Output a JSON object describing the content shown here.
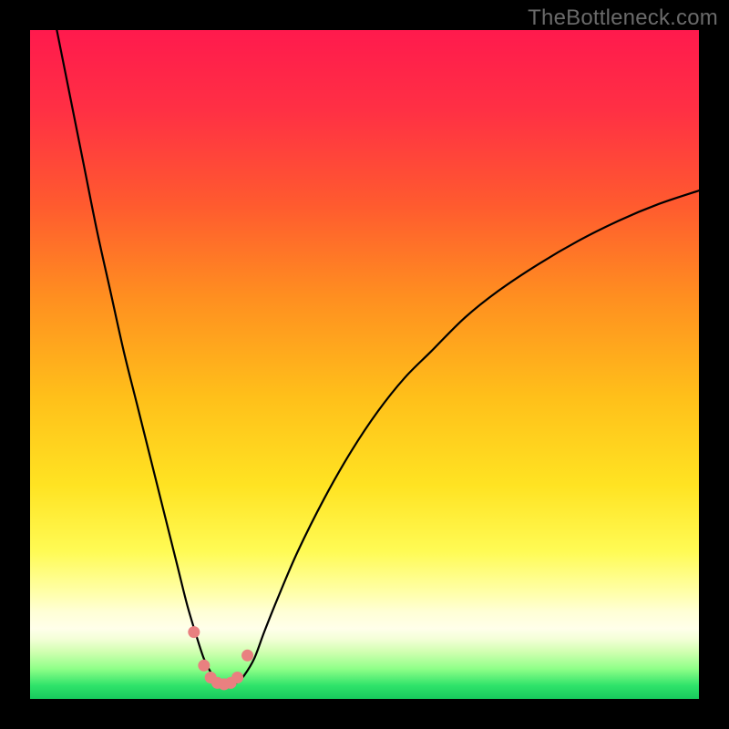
{
  "watermark": {
    "text": "TheBottleneck.com"
  },
  "colors": {
    "frame_bg": "#000000",
    "curve_stroke": "#000000",
    "marker_fill": "#e98080",
    "marker_stroke": "#c95f5f"
  },
  "gradient_stops": [
    {
      "pct": 0,
      "color": "#ff1a4d"
    },
    {
      "pct": 12,
      "color": "#ff3044"
    },
    {
      "pct": 26,
      "color": "#ff5a2f"
    },
    {
      "pct": 40,
      "color": "#ff8f20"
    },
    {
      "pct": 55,
      "color": "#ffc01a"
    },
    {
      "pct": 68,
      "color": "#ffe322"
    },
    {
      "pct": 78,
      "color": "#fffb55"
    },
    {
      "pct": 84,
      "color": "#ffffa8"
    },
    {
      "pct": 87,
      "color": "#ffffd6"
    },
    {
      "pct": 89.5,
      "color": "#ffffea"
    },
    {
      "pct": 91,
      "color": "#f4ffd8"
    },
    {
      "pct": 93,
      "color": "#d0ffb0"
    },
    {
      "pct": 95.5,
      "color": "#8fff88"
    },
    {
      "pct": 98,
      "color": "#2fe36a"
    },
    {
      "pct": 100,
      "color": "#17c95d"
    }
  ],
  "chart_data": {
    "type": "line",
    "title": "",
    "xlabel": "",
    "ylabel": "",
    "xlim": [
      0,
      100
    ],
    "ylim": [
      0,
      100
    ],
    "series": [
      {
        "name": "bottleneck-curve",
        "x": [
          4,
          6,
          8,
          10,
          12,
          14,
          16,
          18,
          20,
          22,
          23.5,
          25,
          26,
          27,
          28,
          29,
          30,
          31,
          32,
          33.5,
          35,
          37,
          40,
          44,
          48,
          52,
          56,
          60,
          65,
          70,
          76,
          82,
          88,
          94,
          100
        ],
        "y": [
          100,
          90,
          80,
          70,
          61,
          52,
          44,
          36,
          28,
          20,
          14,
          9,
          6,
          4,
          2.5,
          2,
          2,
          2.5,
          3.5,
          6,
          10,
          15,
          22,
          30,
          37,
          43,
          48,
          52,
          57,
          61,
          65,
          68.5,
          71.5,
          74,
          76
        ]
      }
    ],
    "markers": {
      "name": "highlight-points",
      "x": [
        24.5,
        26,
        27,
        28,
        29,
        30,
        31,
        32.5
      ],
      "y": [
        10,
        5,
        3.2,
        2.4,
        2.2,
        2.4,
        3.2,
        6.5
      ]
    }
  }
}
